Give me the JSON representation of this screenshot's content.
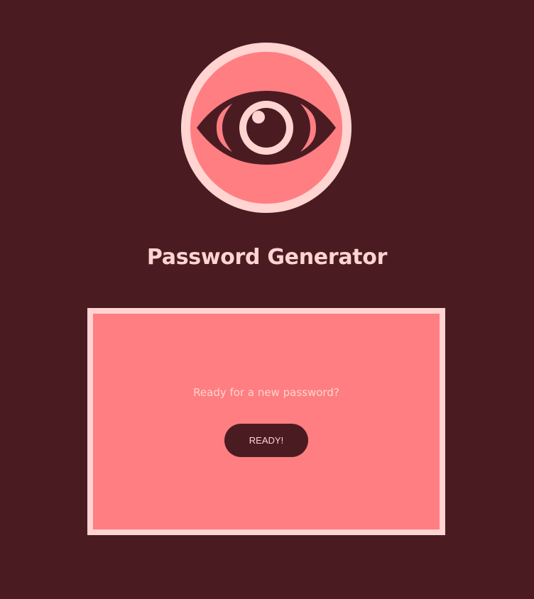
{
  "header": {
    "logo_icon": "eye-icon",
    "title": "Password Generator"
  },
  "card": {
    "prompt": "Ready for a new password?",
    "ready_label": "READY!"
  },
  "colors": {
    "background": "#4a1c22",
    "accent": "#ff7e82",
    "light": "#ffd4d1"
  }
}
